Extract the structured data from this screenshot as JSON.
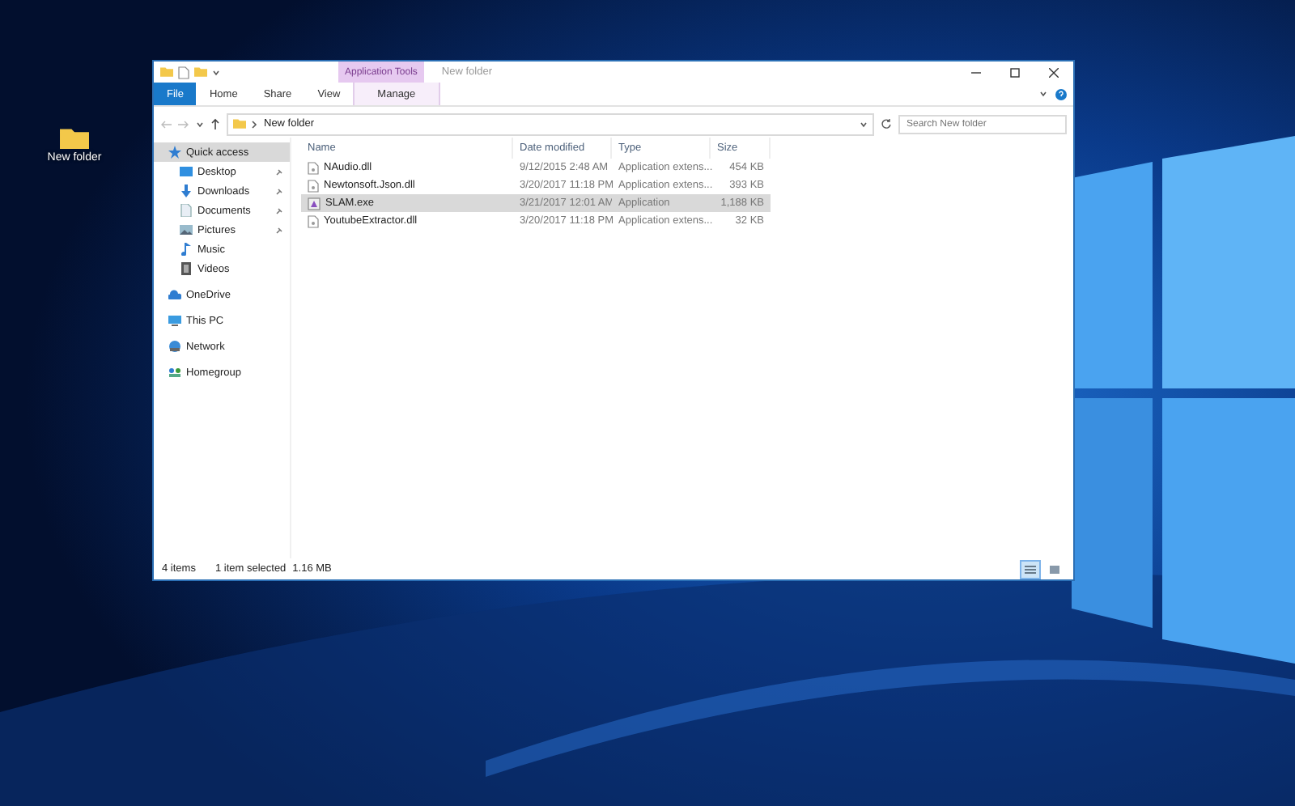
{
  "desktop": {
    "icons": [
      {
        "label": "New folder"
      }
    ]
  },
  "window": {
    "context_tab_group": "Application Tools",
    "title": "New folder",
    "ribbon_tabs": [
      {
        "label": "File",
        "kind": "file",
        "selected": false
      },
      {
        "label": "Home",
        "kind": "tab",
        "selected": false
      },
      {
        "label": "Share",
        "kind": "tab",
        "selected": false
      },
      {
        "label": "View",
        "kind": "tab",
        "selected": false
      },
      {
        "label": "Manage",
        "kind": "context",
        "selected": false
      }
    ],
    "address": {
      "path": "New folder"
    },
    "search": {
      "placeholder": "Search New folder"
    },
    "sidebar": {
      "items": [
        {
          "label": "Quick access",
          "kind": "star",
          "selected": true,
          "children": [
            {
              "label": "Desktop",
              "kind": "desktop",
              "pinned": true,
              "selected": false
            },
            {
              "label": "Downloads",
              "kind": "download",
              "pinned": true,
              "selected": false
            },
            {
              "label": "Documents",
              "kind": "document",
              "pinned": true,
              "selected": false
            },
            {
              "label": "Pictures",
              "kind": "picture",
              "pinned": true,
              "selected": false
            },
            {
              "label": "Music",
              "kind": "music",
              "pinned": false,
              "selected": false
            },
            {
              "label": "Videos",
              "kind": "video",
              "pinned": false,
              "selected": false
            }
          ]
        },
        {
          "label": "OneDrive",
          "kind": "cloud",
          "selected": false
        },
        {
          "label": "This PC",
          "kind": "pc",
          "selected": false
        },
        {
          "label": "Network",
          "kind": "network",
          "selected": false
        },
        {
          "label": "Homegroup",
          "kind": "homegroup",
          "selected": false
        }
      ]
    },
    "table": {
      "columns": [
        "Name",
        "Date modified",
        "Type",
        "Size"
      ],
      "rows": [
        {
          "name": "NAudio.dll",
          "kind": "dll",
          "date": "9/12/2015 2:48 AM",
          "type": "Application extens...",
          "size": "454 KB",
          "selected": false
        },
        {
          "name": "Newtonsoft.Json.dll",
          "kind": "dll",
          "date": "3/20/2017 11:18 PM",
          "type": "Application extens...",
          "size": "393 KB",
          "selected": false
        },
        {
          "name": "SLAM.exe",
          "kind": "exe",
          "date": "3/21/2017 12:01 AM",
          "type": "Application",
          "size": "1,188 KB",
          "selected": true
        },
        {
          "name": "YoutubeExtractor.dll",
          "kind": "dll",
          "date": "3/20/2017 11:18 PM",
          "type": "Application extens...",
          "size": "32 KB",
          "selected": false
        }
      ]
    },
    "status_bar": {
      "item_count": "4 items",
      "selection": "1 item selected",
      "size": "1.16 MB"
    },
    "view_buttons": [
      {
        "kind": "details",
        "selected": true
      },
      {
        "kind": "large",
        "selected": false
      }
    ]
  }
}
